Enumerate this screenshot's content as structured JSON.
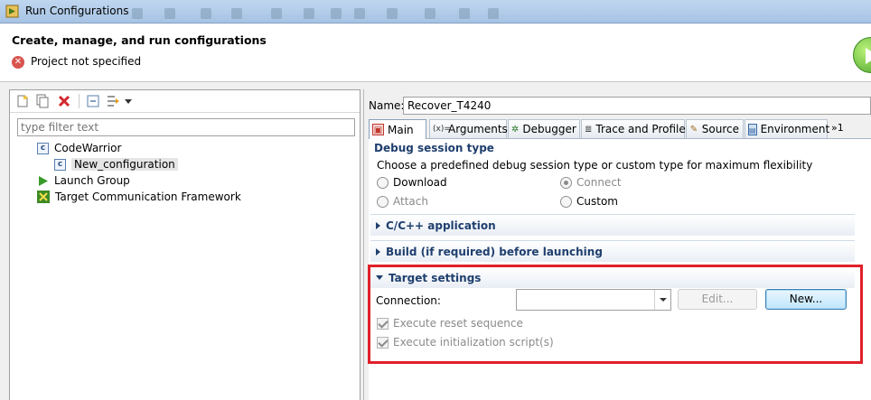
{
  "window": {
    "title": "Run Configurations"
  },
  "header": {
    "title": "Create, manage, and run configurations",
    "error_message": "Project not specified"
  },
  "left_panel": {
    "filter_placeholder": "type filter text",
    "tree": [
      {
        "label": "CodeWarrior",
        "icon": "codewarrior-config-icon",
        "level": 0
      },
      {
        "label": "New_configuration",
        "icon": "codewarrior-config-icon",
        "level": 1,
        "selected": true
      },
      {
        "label": "Launch Group",
        "icon": "launch-group-icon",
        "level": 0
      },
      {
        "label": "Target Communication Framework",
        "icon": "tcf-icon",
        "level": 0
      }
    ]
  },
  "right_panel": {
    "name_label": "Name:",
    "name_value": "Recover_T4240",
    "tabs": [
      {
        "label": "Main",
        "icon": "main-tab-icon",
        "active": true
      },
      {
        "label": "Arguments",
        "icon": "arguments-icon"
      },
      {
        "label": "Debugger",
        "icon": "debugger-icon"
      },
      {
        "label": "Trace and Profile",
        "icon": "trace-icon"
      },
      {
        "label": "Source",
        "icon": "source-icon"
      },
      {
        "label": "Environment",
        "icon": "environment-icon"
      }
    ],
    "overflow_tabs": "»1",
    "debug_session": {
      "title": "Debug session type",
      "description": "Choose a predefined debug session type or custom type for maximum flexibility",
      "options": [
        {
          "label": "Download",
          "enabled": true,
          "checked": false
        },
        {
          "label": "Connect",
          "enabled": false,
          "checked": true
        },
        {
          "label": "Attach",
          "enabled": false,
          "checked": false
        },
        {
          "label": "Custom",
          "enabled": true,
          "checked": false
        }
      ]
    },
    "sections": {
      "cpp_application": "C/C++ application",
      "build": "Build (if required) before launching",
      "target_settings": "Target settings"
    },
    "target": {
      "connection_label": "Connection:",
      "connection_value": "",
      "edit_button": "Edit...",
      "new_button": "New...",
      "reset_sequence": "Execute reset sequence",
      "init_script": "Execute initialization script(s)"
    }
  },
  "colors": {
    "highlight_border": "#e0202b",
    "section_title": "#1f3f6e"
  }
}
